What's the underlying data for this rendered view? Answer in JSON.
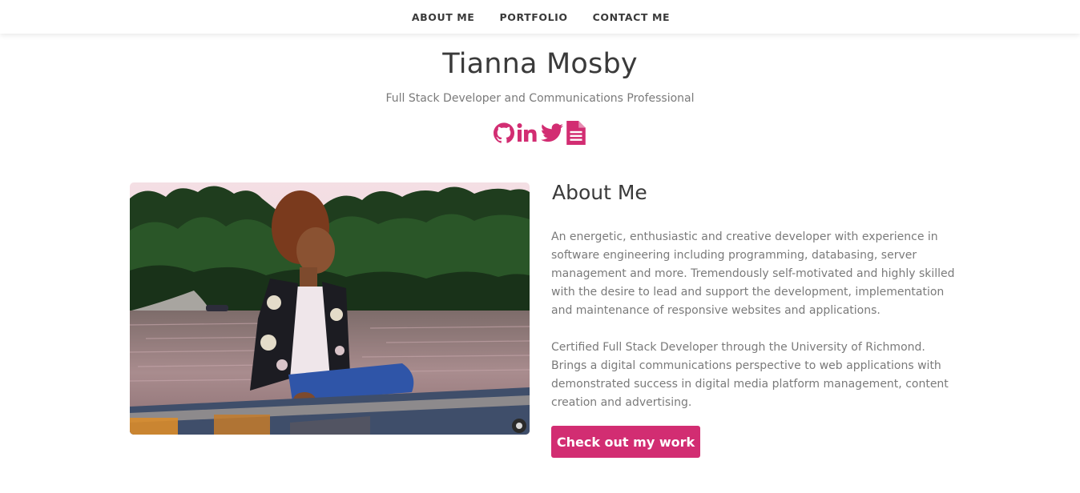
{
  "nav": {
    "items": [
      {
        "label": "ABOUT ME"
      },
      {
        "label": "PORTFOLIO"
      },
      {
        "label": "CONTACT ME"
      }
    ]
  },
  "hero": {
    "name": "Tianna Mosby",
    "subtitle": "Full Stack Developer and Communications Professional"
  },
  "social": [
    {
      "icon": "github-icon"
    },
    {
      "icon": "linkedin-icon"
    },
    {
      "icon": "twitter-icon"
    },
    {
      "icon": "resume-document-icon"
    }
  ],
  "about": {
    "title": "About Me",
    "paragraph_1": "An energetic, enthusiastic and creative developer with experience in software engineering including programming, databasing, server management and more. Tremendously self-motivated and highly skilled with the desire to lead and support the development, implementation and maintenance of responsive websites and applications.",
    "paragraph_2": "Certified Full Stack Developer through the University of Richmond. Brings a digital communications perspective to web applications with demonstrated success in digital media platform management, content creation and advertising.",
    "cta_label": "Check out my work"
  },
  "colors": {
    "accent": "#d22d72",
    "heading": "#3a3a3a",
    "body_text": "#7a7a7a"
  }
}
